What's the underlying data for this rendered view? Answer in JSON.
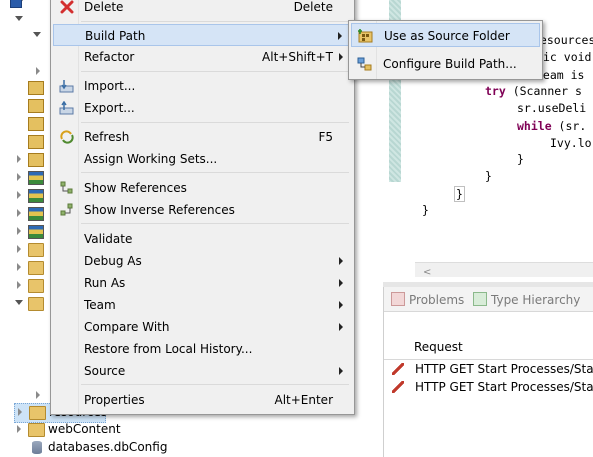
{
  "editor": {
    "code_lines": [
      {
        "plain": "resources",
        "kw": ""
      },
      {
        "plain": "ic void",
        "kw": ""
      },
      {
        "plain": "ream is",
        "kw": ""
      },
      {
        "plain": " (Scanner s",
        "kw": "try"
      },
      {
        "plain": "sr.useDeli",
        "kw": ""
      },
      {
        "plain": " (sr.",
        "kw": "while"
      },
      {
        "plain": "Ivy.lo",
        "kw": ""
      },
      {
        "plain": "}",
        "kw": ""
      },
      {
        "plain": "}",
        "kw": ""
      },
      {
        "plain": "}",
        "kw": ""
      },
      {
        "plain": "}",
        "kw": ""
      }
    ],
    "scroll_left_glyph": "<"
  },
  "panel": {
    "tabs": [
      {
        "label": "Problems",
        "icon": "problems-icon"
      },
      {
        "label": "Type Hierarchy",
        "icon": "type-hierarchy-icon"
      }
    ],
    "column_header": "Request",
    "rows": [
      "HTTP GET Start Processes/Starts...",
      "HTTP GET Start Processes/Starts..."
    ]
  },
  "tree": {
    "bottom_items": [
      {
        "label": "resources",
        "icon": "folder-icon"
      },
      {
        "label": "webContent",
        "icon": "folder-icon"
      },
      {
        "label": "databases.dbConfig",
        "icon": "database-config-icon"
      }
    ]
  },
  "context_menu": {
    "items": [
      {
        "label": "Delete",
        "shortcut": "Delete",
        "icon": "delete-icon"
      },
      {
        "label": "Build Path",
        "shortcut": "",
        "submenu": true
      },
      {
        "label": "Refactor",
        "shortcut": "Alt+Shift+T",
        "submenu": true
      },
      {
        "label": "Import...",
        "shortcut": "",
        "icon": "import-icon"
      },
      {
        "label": "Export...",
        "shortcut": "",
        "icon": "export-icon"
      },
      {
        "label": "Refresh",
        "shortcut": "F5",
        "icon": "refresh-icon"
      },
      {
        "label": "Assign Working Sets...",
        "shortcut": ""
      },
      {
        "label": "Show References",
        "shortcut": "",
        "icon": "references-icon"
      },
      {
        "label": "Show Inverse References",
        "shortcut": "",
        "icon": "inverse-references-icon"
      },
      {
        "label": "Validate",
        "shortcut": ""
      },
      {
        "label": "Debug As",
        "shortcut": "",
        "submenu": true
      },
      {
        "label": "Run As",
        "shortcut": "",
        "submenu": true
      },
      {
        "label": "Team",
        "shortcut": "",
        "submenu": true
      },
      {
        "label": "Compare With",
        "shortcut": "",
        "submenu": true
      },
      {
        "label": "Restore from Local History...",
        "shortcut": ""
      },
      {
        "label": "Source",
        "shortcut": "",
        "submenu": true
      },
      {
        "label": "Properties",
        "shortcut": "Alt+Enter"
      }
    ],
    "highlighted": "Build Path"
  },
  "submenu": {
    "items": [
      {
        "label": "Use as Source Folder",
        "icon": "source-folder-icon"
      },
      {
        "label": "Configure Build Path...",
        "icon": "build-path-icon"
      }
    ],
    "highlighted": "Use as Source Folder"
  },
  "colors": {
    "menu_bg": "#f0f0f0",
    "highlight_bg": "#d5e4f6",
    "highlight_border": "#a9c5ea",
    "keyword": "#7f0055"
  }
}
